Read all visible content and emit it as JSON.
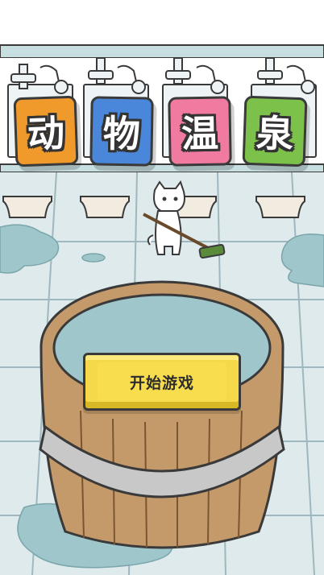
{
  "title": {
    "chars": [
      {
        "text": "动",
        "color": "#f19a2c"
      },
      {
        "text": "物",
        "color": "#4a86d9"
      },
      {
        "text": "温",
        "color": "#f07aa0"
      },
      {
        "text": "泉",
        "color": "#7cc24a"
      }
    ]
  },
  "menu": {
    "start_label": "开始游戏"
  },
  "colors": {
    "floor": "#dfeaec",
    "floor_grid": "#9fb7be",
    "water": "#9fc6cb",
    "wood": "#c59a6a",
    "button": "#f5d94a"
  }
}
